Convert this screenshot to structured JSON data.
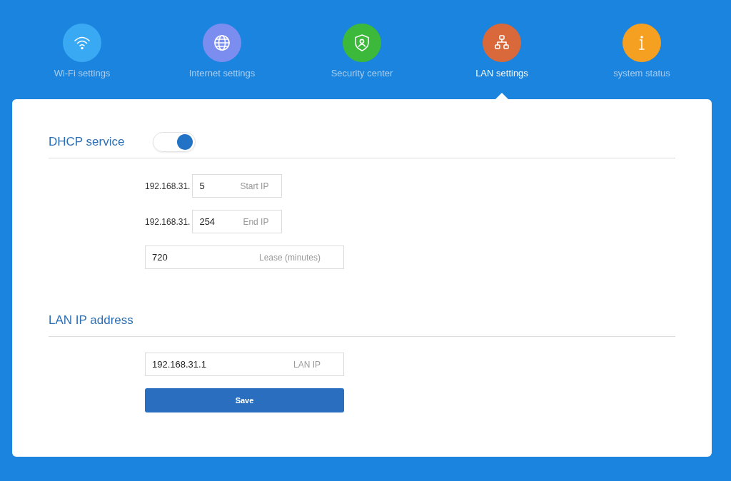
{
  "nav": [
    {
      "label": "Wi-Fi settings",
      "kind": "wifi",
      "color": "#3aa9f3",
      "selected": false
    },
    {
      "label": "Internet settings",
      "kind": "globe",
      "color": "#7b8ef0",
      "selected": false
    },
    {
      "label": "Security center",
      "kind": "shield",
      "color": "#3cb83a",
      "selected": false
    },
    {
      "label": "LAN settings",
      "kind": "network",
      "color": "#d9683a",
      "selected": true
    },
    {
      "label": "system status",
      "kind": "info",
      "color": "#f5a020",
      "selected": false
    }
  ],
  "sections": [
    {
      "title": "DHCP service",
      "toggle": {
        "on": true
      },
      "fields": [
        {
          "prefix": "192.168.31.",
          "value": "5",
          "hint": "Start IP"
        },
        {
          "prefix": "192.168.31.",
          "value": "254",
          "hint": "End IP"
        },
        {
          "value": "720",
          "hint": "Lease (minutes)"
        }
      ]
    },
    {
      "title": "LAN IP address",
      "fields": [
        {
          "value": "192.168.31.1",
          "hint": "LAN IP"
        }
      ],
      "button": "Save"
    }
  ]
}
